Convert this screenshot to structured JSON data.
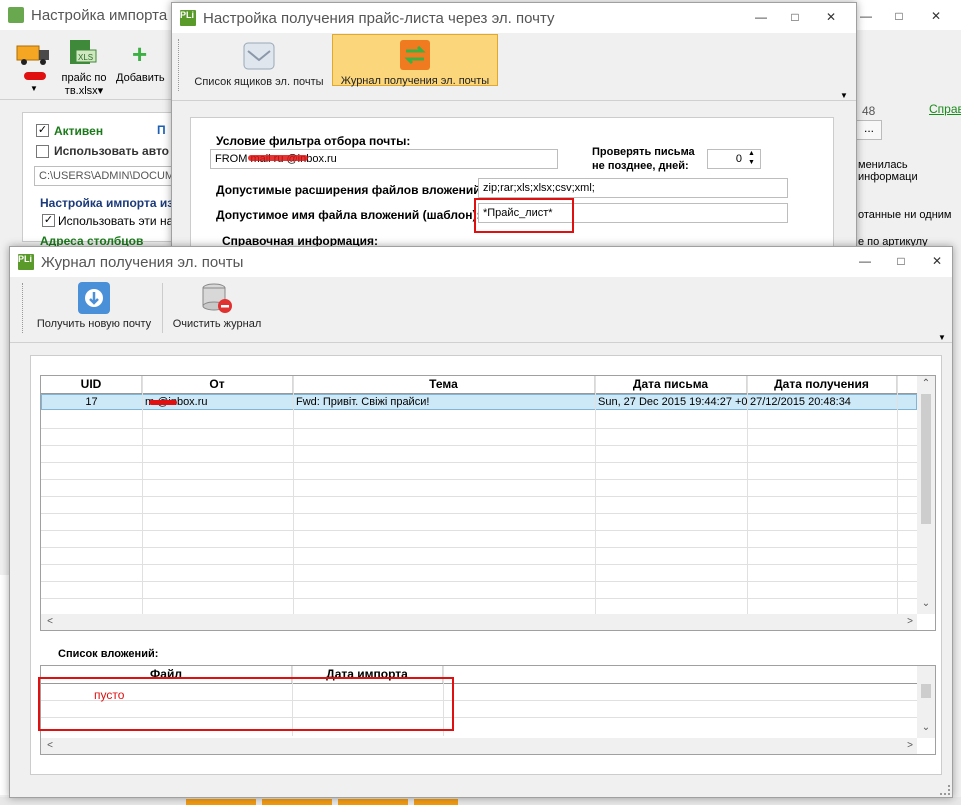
{
  "bg_window": {
    "title": "Настройка импорта",
    "toolbar": {
      "file_label_line1": "прайс по",
      "file_label_line2": "тв.xlsx",
      "add_label": "Добавить"
    },
    "active_label": "Активен",
    "active_tab_letter": "П",
    "use_auto_label": "Использовать авто",
    "path_value": "C:\\USERS\\ADMIN\\DOCUME",
    "import_section_label": "Настройка импорта из",
    "use_these_label": "Использовать эти нас",
    "columns_label": "Адреса столбцов",
    "right_count": "48",
    "right_link": "Справ",
    "right_btn": "...",
    "right_text1": "менилась информаци",
    "right_text2": "отанные ни одним",
    "right_text3": "е по артикулу"
  },
  "mid_window": {
    "title": "Настройка получения прайс-листа через эл. почту",
    "toolbar": {
      "mailboxes_label": "Список ящиков эл. почты",
      "journal_label": "Журнал получения эл. почты"
    },
    "filter_label": "Условие фильтра отбора почты:",
    "filter_value": "FROM  mail ru  @inbox.ru",
    "check_label_line1": "Проверять письма",
    "check_label_line2": "не позднее, дней:",
    "days_value": "0",
    "ext_label": "Допустимые расширения файлов вложений:",
    "ext_value": "zip;rar;xls;xlsx;csv;xml;",
    "filename_label": "Допустимое имя файла вложений (шаблон):",
    "filename_value": "*Прайс_лист*",
    "ref_label": "Справочная информация:"
  },
  "front_window": {
    "title": "Журнал получения эл. почты",
    "toolbar": {
      "get_mail_label": "Получить новую почту",
      "clear_label": "Очистить журнал"
    },
    "mail_table": {
      "columns": [
        "UID",
        "От",
        "Тема",
        "Дата письма",
        "Дата получения"
      ],
      "rows": [
        {
          "uid": "17",
          "from": "m     @inbox.ru",
          "subject": "Fwd: Привіт. Свіжі прайси!",
          "mail_date": "Sun, 27 Dec 2015 19:44:27 +0",
          "received": "27/12/2015 20:48:34"
        }
      ]
    },
    "attachments_label": "Список вложений:",
    "attach_table": {
      "columns": [
        "Файл",
        "Дата импорта"
      ],
      "empty_text": "пусто"
    }
  },
  "colors": {
    "accent_highlight": "#cde8f6",
    "red_annotation": "#e01010",
    "green_text": "#1a7a1a",
    "link_blue": "#1a5fb4"
  }
}
